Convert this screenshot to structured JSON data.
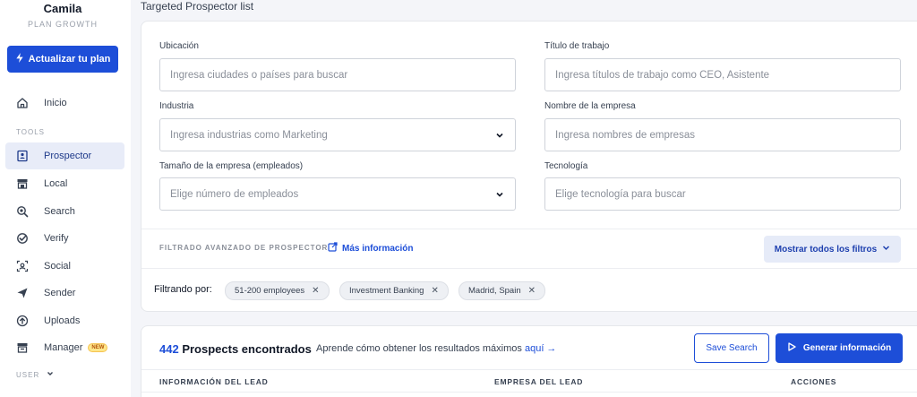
{
  "user": {
    "name": "Camila",
    "plan": "PLAN GROWTH"
  },
  "upgrade": {
    "label": "Actualizar tu plan"
  },
  "nav": {
    "home": "Inicio",
    "tools_label": "TOOLS",
    "items": [
      {
        "label": "Prospector",
        "icon": "prospector-icon",
        "active": true
      },
      {
        "label": "Local",
        "icon": "store-icon"
      },
      {
        "label": "Search",
        "icon": "search-icon"
      },
      {
        "label": "Verify",
        "icon": "verify-icon"
      },
      {
        "label": "Social",
        "icon": "social-icon"
      },
      {
        "label": "Sender",
        "icon": "send-icon"
      },
      {
        "label": "Uploads",
        "icon": "upload-icon"
      },
      {
        "label": "Manager",
        "icon": "manager-icon",
        "badge": "NEW"
      }
    ],
    "user_label": "USER"
  },
  "page": {
    "title": "Targeted Prospector list"
  },
  "filters": {
    "location": {
      "label": "Ubicación",
      "placeholder": "Ingresa ciudades o países para buscar"
    },
    "job_title": {
      "label": "Título de trabajo",
      "placeholder": "Ingresa títulos de trabajo como CEO, Asistente"
    },
    "industry": {
      "label": "Industria",
      "placeholder": "Ingresa industrias como Marketing"
    },
    "company_name": {
      "label": "Nombre de la empresa",
      "placeholder": "Ingresa nombres de empresas"
    },
    "company_size": {
      "label": "Tamaño de la empresa (empleados)",
      "placeholder": "Elige número de empleados"
    },
    "technology": {
      "label": "Tecnología",
      "placeholder": "Elige tecnología para buscar"
    }
  },
  "advanced": {
    "label": "FILTRADO AVANZADO DE PROSPECTOR",
    "more_info": "Más información",
    "show_all": "Mostrar todos los filtros"
  },
  "active_filters": {
    "label": "Filtrando por:",
    "chips": [
      "51-200 employees",
      "Investment Banking",
      "Madrid, Spain"
    ]
  },
  "results": {
    "count": "442",
    "count_label": "Prospects encontrados",
    "hint": "Aprende cómo obtener los resultados máximos",
    "hint_link": "aquí →",
    "save_search": "Save Search",
    "generate": "Generar información",
    "columns": [
      "INFORMACIÓN DEL LEAD",
      "EMPRESA DEL LEAD",
      "ACCIONES"
    ]
  },
  "colors": {
    "accent": "#1d4ed8",
    "active_bg": "#e8ecf8",
    "page_bg": "#f4f5f9"
  }
}
